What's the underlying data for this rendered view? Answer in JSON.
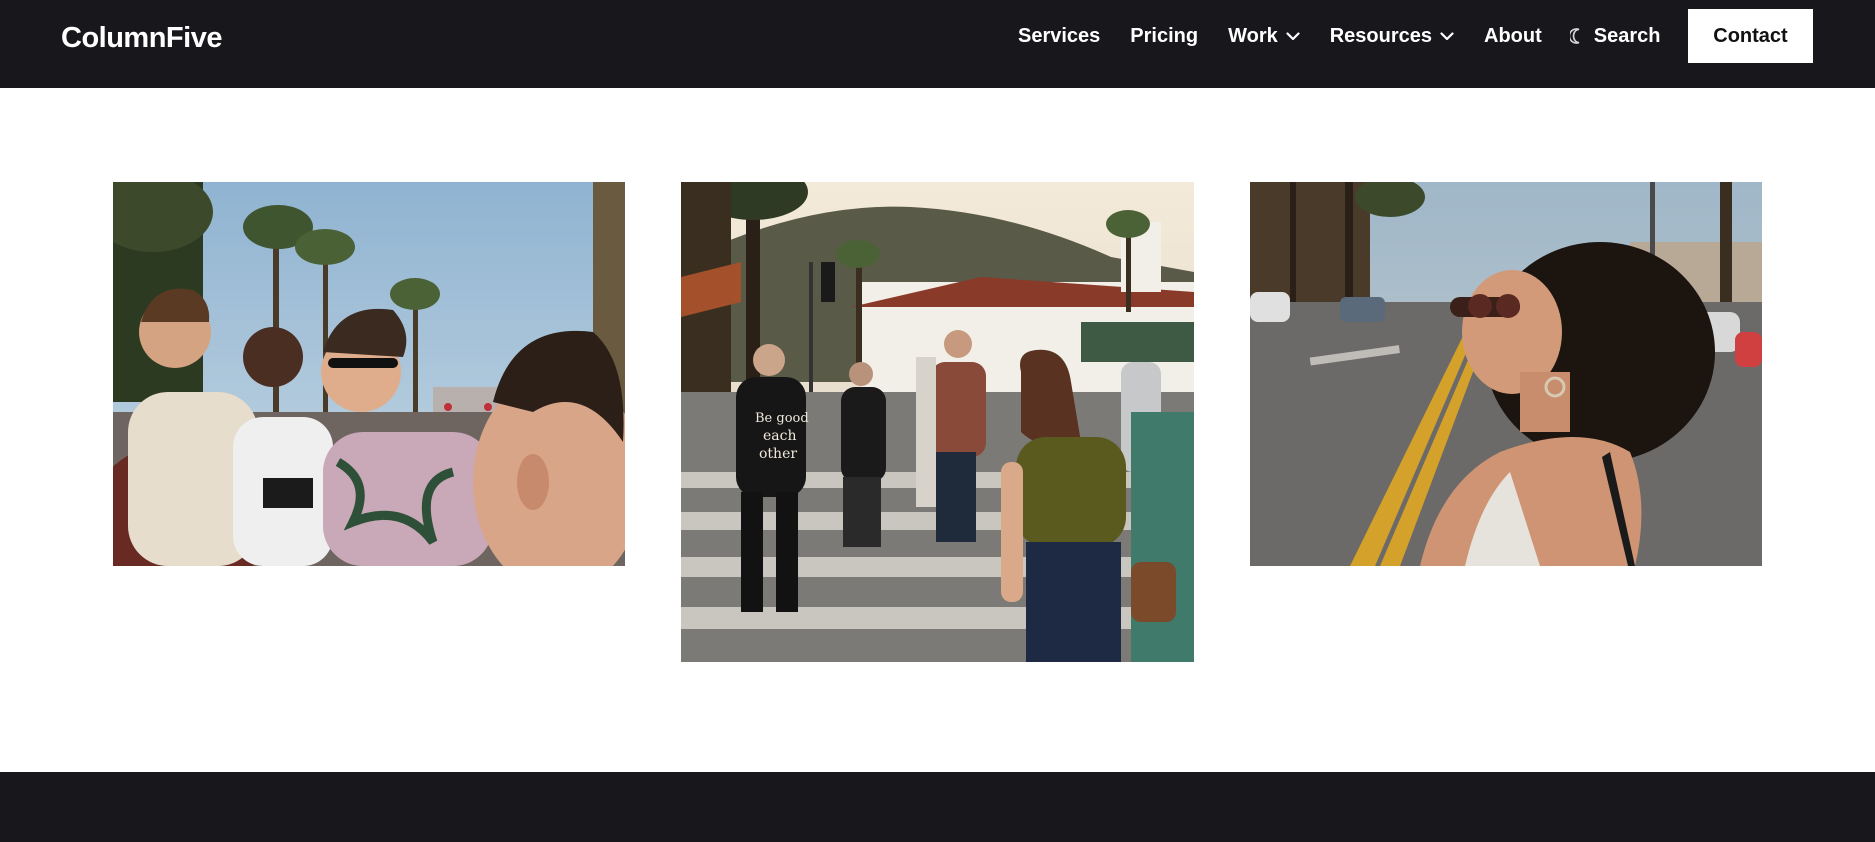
{
  "brand": {
    "name": "ColumnFive"
  },
  "nav": {
    "services": "Services",
    "pricing": "Pricing",
    "work": "Work",
    "resources": "Resources",
    "about": "About",
    "search": "Search",
    "contact": "Contact"
  },
  "icons": {
    "work_dropdown": "chevron-down-icon",
    "resources_dropdown": "chevron-down-icon",
    "theme_toggle": "moon-icon"
  },
  "colors": {
    "header_bg": "#18171c",
    "footer_bg": "#18171c",
    "button_bg": "#ffffff",
    "nav_text": "#ffffff"
  },
  "gallery": {
    "photo_1": {
      "subject": "group-on-street"
    },
    "photo_2": {
      "subject": "crowd-crossing-street",
      "shirt_text": "Be good to each other"
    },
    "photo_3": {
      "subject": "woman-with-sunglasses"
    }
  }
}
